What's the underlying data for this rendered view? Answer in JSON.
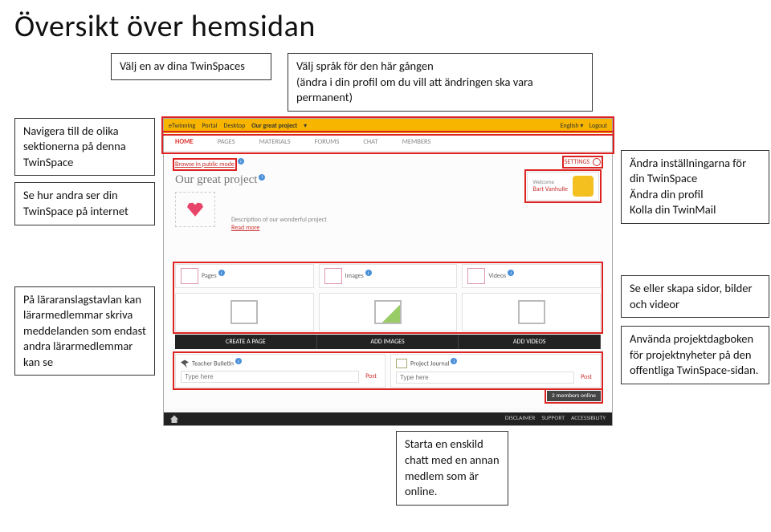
{
  "title": "Översikt över hemsidan",
  "top": {
    "left": "Välj en av dina TwinSpaces",
    "right_l1": "Välj språk för den här gången",
    "right_l2": "(ändra i din profil om du vill att ändringen ska vara permanent)"
  },
  "left": {
    "box1_l1": "Navigera till de olika sektionerna på denna TwinSpace",
    "box2_l1": "Se hur andra ser din TwinSpace på internet",
    "box3_l1": "På läraranslagstavlan kan lärarmedlemmar skriva meddelanden som endast andra lärarmedlemmar kan se"
  },
  "right": {
    "box1": "Ändra inställningarna för din TwinSpace\nÄndra din profil\nKolla din TwinMail",
    "box2": "Se eller skapa sidor, bilder och videor",
    "box3": "Använda projektdagboken för projektnyheter på den offentliga TwinSpace-sidan."
  },
  "bottom": "Starta en enskild chatt med en annan medlem som är online.",
  "shot": {
    "topbar": {
      "portal": "Portal",
      "desktop": "Desktop",
      "project": "Our great project",
      "english": "English",
      "logout": "Logout",
      "brand": "eTwinning"
    },
    "nav": [
      "HOME",
      "PAGES",
      "MATERIALS",
      "FORUMS",
      "CHAT",
      "MEMBERS"
    ],
    "browse": "Browse in public mode",
    "settings": "SETTINGS",
    "welcome_label": "Welcome",
    "welcome_name": "Bart Vanhulle",
    "projtitle": "Our great project",
    "desc": "Description of our wonderful project",
    "readmore": "Read more",
    "tiles": {
      "pages": "Pages",
      "images": "Images",
      "videos": "Videos"
    },
    "buttons": {
      "create": "CREATE A PAGE",
      "addimg": "ADD IMAGES",
      "addvid": "ADD VIDEOS"
    },
    "journals": {
      "tb": "Teacher Bulletin",
      "pj": "Project Journal",
      "type": "Type here",
      "post": "Post"
    },
    "footer": {
      "online": "2 members online",
      "disc": "DISCLAIMER",
      "sup": "SUPPORT",
      "acc": "ACCESSIBILITY"
    }
  }
}
